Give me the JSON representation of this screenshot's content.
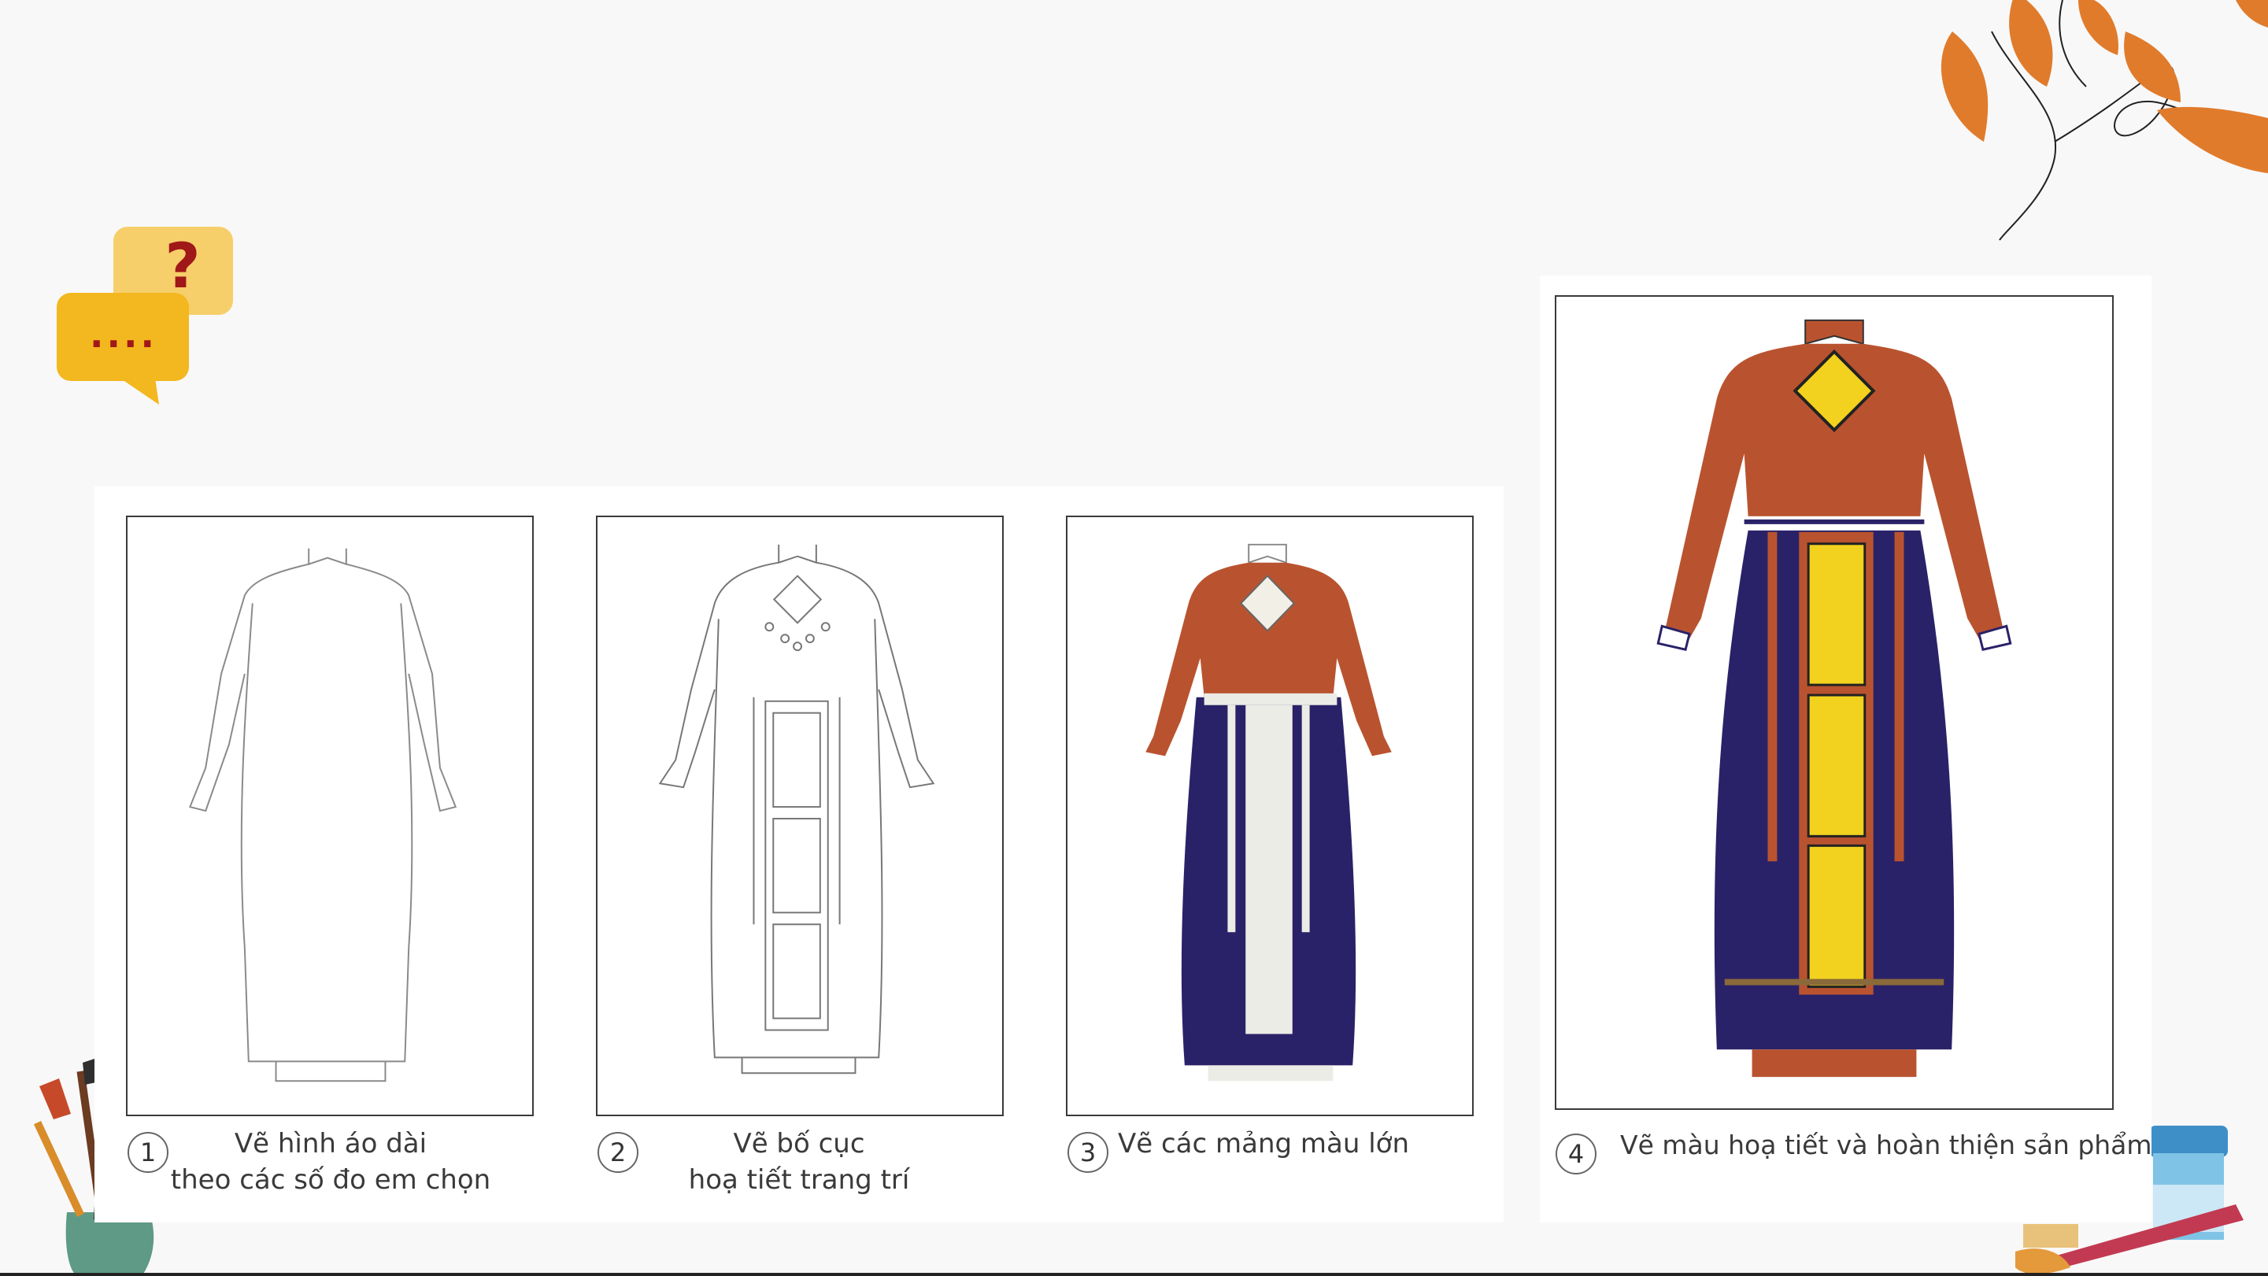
{
  "chat_icon": {
    "question_mark": "?",
    "dots": "...."
  },
  "steps": [
    {
      "number": "1",
      "lines": [
        "Vẽ hình áo dài",
        "theo các số đo em chọn"
      ]
    },
    {
      "number": "2",
      "lines": [
        "Vẽ bố cục",
        "hoạ tiết trang trí"
      ]
    },
    {
      "number": "3",
      "lines": [
        "Vẽ các mảng màu lớn"
      ]
    },
    {
      "number": "4",
      "lines": [
        "Vẽ màu hoạ tiết và hoàn thiện sản phẩm"
      ]
    }
  ],
  "colors": {
    "background": "#f8f8f8",
    "leaf": "#e07b2c",
    "bodice": "#b9532f",
    "skirt": "#2a2268",
    "panel_yellow": "#f2d21f",
    "icon_front": "#f3b71f",
    "icon_back": "#f6cf6a",
    "icon_mark": "#a01818"
  }
}
